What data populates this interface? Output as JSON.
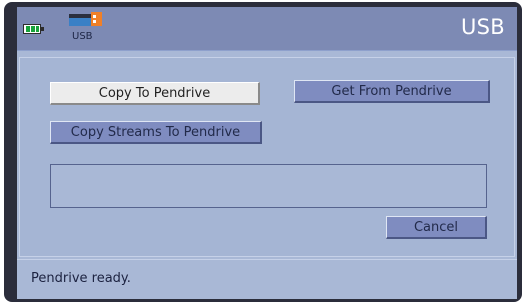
{
  "header": {
    "title": "USB",
    "battery_icon": "battery-icon",
    "usb_icon": "usb-drive-icon",
    "usb_label": "USB"
  },
  "actions": {
    "copy_to_pendrive": "Copy To Pendrive",
    "get_from_pendrive": "Get From Pendrive",
    "copy_streams": "Copy Streams To Pendrive",
    "cancel": "Cancel"
  },
  "message": {
    "text": ""
  },
  "status": {
    "text": "Pendrive ready."
  },
  "colors": {
    "header": "#7d8ab4",
    "background": "#a9b8d6",
    "button": "#7f8cc0",
    "selected_button": "#ececec",
    "battery": "#17a33a",
    "usb_body": "#3a80c6",
    "usb_plug": "#f08028"
  }
}
